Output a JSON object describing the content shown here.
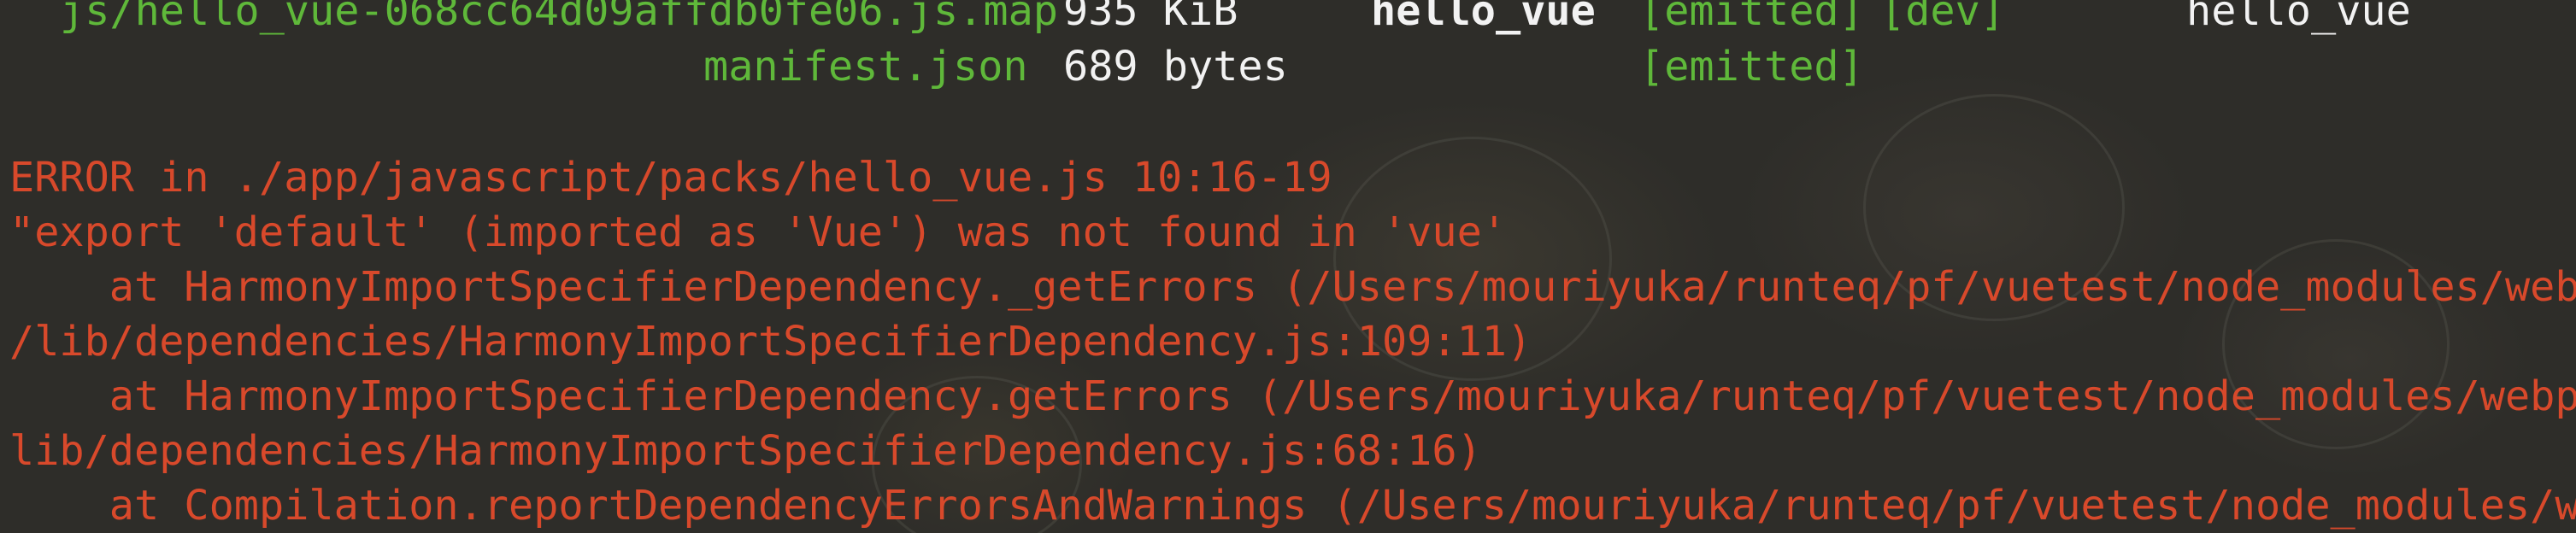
{
  "asset_rows": [
    {
      "asset": "js/hello_vue-068cc64d09affdb0fe06.js.map",
      "size": "935 KiB",
      "chunk": "hello_vue",
      "status": "[emitted]",
      "flag": "[dev]",
      "chunk_name": "hello_vue"
    },
    {
      "asset": "manifest.json",
      "size": "689 bytes",
      "chunk": "",
      "status": "[emitted]",
      "flag": "",
      "chunk_name": ""
    }
  ],
  "error": {
    "header": "ERROR in ./app/javascript/packs/hello_vue.js 10:16-19",
    "message": "\"export 'default' (imported as 'Vue') was not found in 'vue'",
    "stack": [
      "    at HarmonyImportSpecifierDependency._getErrors (/Users/mouriyuka/runteq/pf/vuetest/node_modules/webpack",
      "/lib/dependencies/HarmonyImportSpecifierDependency.js:109:11)",
      "    at HarmonyImportSpecifierDependency.getErrors (/Users/mouriyuka/runteq/pf/vuetest/node_modules/webpack/",
      "lib/dependencies/HarmonyImportSpecifierDependency.js:68:16)",
      "    at Compilation.reportDependencyErrorsAndWarnings (/Users/mouriyuka/runteq/pf/vuetest/node_modules/webpa"
    ]
  },
  "colors": {
    "asset_green": "#5fb83a",
    "error_red": "#d8492b",
    "text_white": "#f2f2f2",
    "background": "#2e2d29"
  }
}
